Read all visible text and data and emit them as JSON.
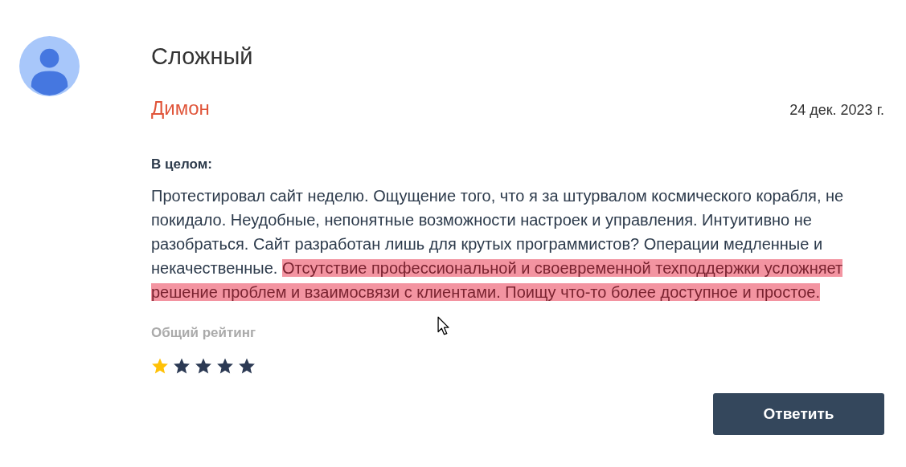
{
  "review": {
    "title": "Сложный",
    "author": "Димон",
    "date": "24 дек. 2023 г.",
    "section_label": "В целом:",
    "body": {
      "text": "Протестировал сайт неделю. Ощущение того, что я за штурвалом космического корабля, не покидало. Неудобные, непонятные возможности настроек и управления. Интуитивно не разобраться. Сайт разработан лишь для крутых программистов? Операции медленные и некачественные. ",
      "highlighted": "Отсутствие профессиональной и своевременной техподдержки усложняет решение проблем и взаимосвязи с клиентами. Поищу что-то более доступное и простое."
    },
    "rating_label": "Общий рейтинг",
    "stars": 1
  },
  "reply_button": "Ответить"
}
